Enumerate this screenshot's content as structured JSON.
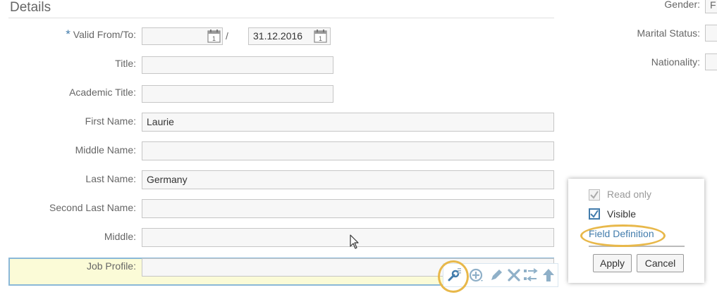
{
  "section": {
    "title": "Details"
  },
  "fields": {
    "valid_from_to": {
      "label": "Valid From/To:",
      "required_mark": "*",
      "from_value": "",
      "separator": "/",
      "to_value": "31.12.2016"
    },
    "title": {
      "label": "Title:",
      "value": ""
    },
    "academic_title": {
      "label": "Academic Title:",
      "value": ""
    },
    "first_name": {
      "label": "First Name:",
      "value": "Laurie"
    },
    "middle_name": {
      "label": "Middle Name:",
      "value": ""
    },
    "last_name": {
      "label": "Last Name:",
      "value": "Germany"
    },
    "second_last_name": {
      "label": "Second Last Name:",
      "value": ""
    },
    "middle": {
      "label": "Middle:",
      "value": ""
    },
    "job_profile": {
      "label": "Job Profile:",
      "value": ""
    }
  },
  "right_fields": {
    "gender": {
      "label": "Gender:",
      "value": "F"
    },
    "marital_status": {
      "label": "Marital Status:",
      "value": ""
    },
    "nationality": {
      "label": "Nationality:",
      "value": ""
    }
  },
  "toolbar": {
    "icons": [
      "wrench-icon",
      "add-icon",
      "edit-icon",
      "delete-icon",
      "move-icon",
      "up-arrow-icon"
    ]
  },
  "popup": {
    "read_only_label": "Read only",
    "read_only_checked": true,
    "visible_label": "Visible",
    "visible_checked": true,
    "field_definition_link": "Field Definition",
    "apply_label": "Apply",
    "cancel_label": "Cancel"
  },
  "colors": {
    "accent": "#427cac",
    "highlight": "#e8b84a",
    "selected_row_bg": "#fbfbd7",
    "selected_row_border": "#8ab8d8"
  }
}
